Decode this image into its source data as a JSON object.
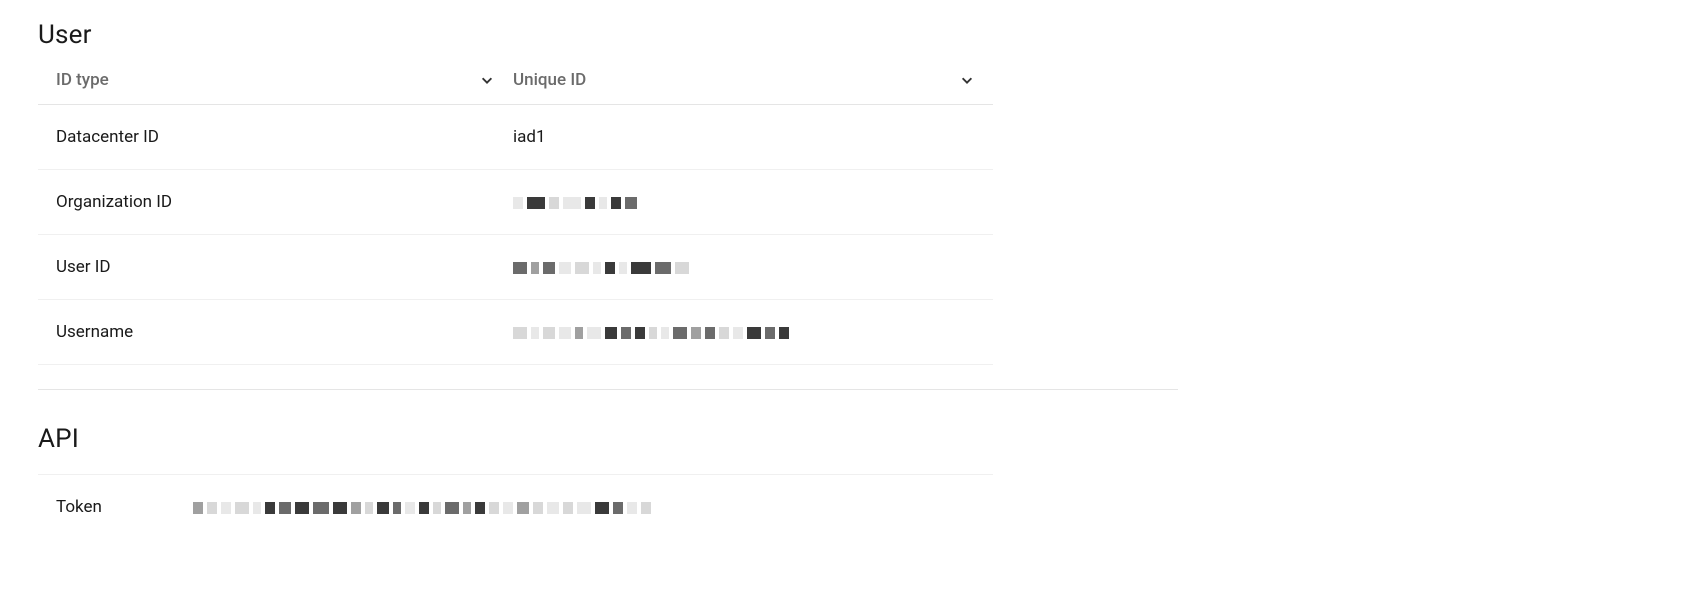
{
  "user_section": {
    "title": "User",
    "headers": {
      "id_type": "ID type",
      "unique_id": "Unique ID"
    },
    "rows": [
      {
        "label": "Datacenter ID",
        "value": "iad1",
        "redacted": false
      },
      {
        "label": "Organization ID",
        "value": "",
        "redacted": true
      },
      {
        "label": "User ID",
        "value": "",
        "redacted": true
      },
      {
        "label": "Username",
        "value": "",
        "redacted": true
      }
    ]
  },
  "api_section": {
    "title": "API",
    "rows": [
      {
        "label": "Token",
        "value": "",
        "redacted": true
      }
    ]
  }
}
